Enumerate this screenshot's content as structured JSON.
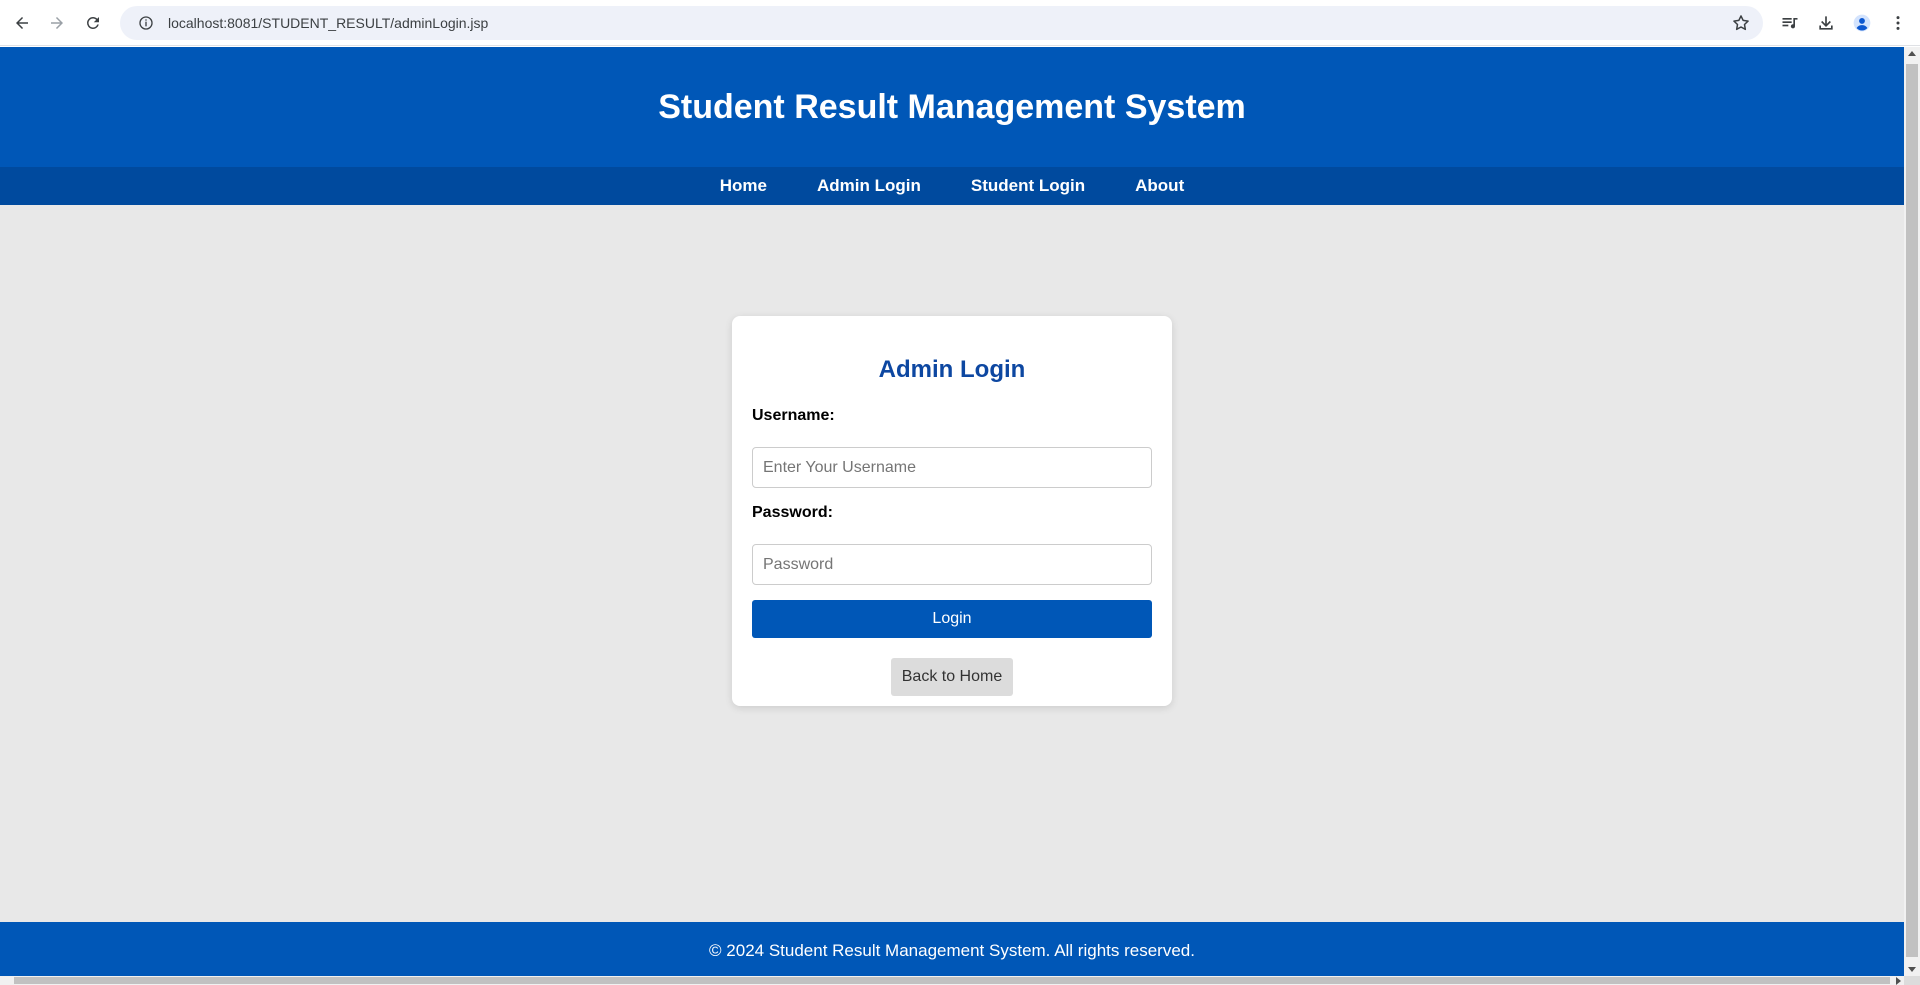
{
  "browser": {
    "url": "localhost:8081/STUDENT_RESULT/adminLogin.jsp"
  },
  "header": {
    "title": "Student Result Management System"
  },
  "nav": {
    "items": [
      "Home",
      "Admin Login",
      "Student Login",
      "About"
    ]
  },
  "login_card": {
    "title": "Admin Login",
    "username_label": "Username:",
    "username_placeholder": "Enter Your Username",
    "username_value": "",
    "password_label": "Password:",
    "password_placeholder": "Password",
    "password_value": "",
    "login_button": "Login",
    "back_button": "Back to Home"
  },
  "footer": {
    "text": "© 2024 Student Result Management System. All rights reserved."
  },
  "colors": {
    "header_blue": "#0057b7",
    "nav_blue": "#004a9e",
    "card_title": "#0d47a1",
    "page_bg": "#e8e8e8"
  },
  "icons": [
    "back-arrow-icon",
    "forward-arrow-icon",
    "reload-icon",
    "site-info-icon",
    "bookmark-star-icon",
    "media-controls-icon",
    "download-icon",
    "profile-icon",
    "more-menu-icon"
  ]
}
